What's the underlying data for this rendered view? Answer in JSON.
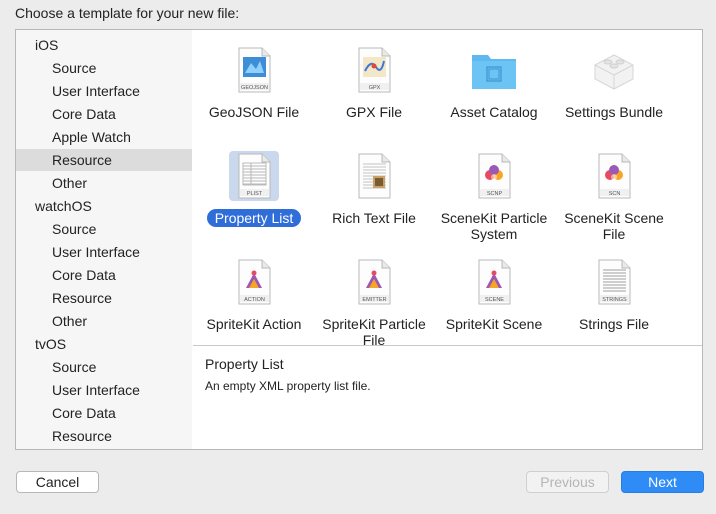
{
  "dialog": {
    "title": "Choose a template for your new file:"
  },
  "sidebar": {
    "items": [
      {
        "label": "iOS",
        "kind": "cat",
        "selected": false
      },
      {
        "label": "Source",
        "kind": "sub",
        "selected": false
      },
      {
        "label": "User Interface",
        "kind": "sub",
        "selected": false
      },
      {
        "label": "Core Data",
        "kind": "sub",
        "selected": false
      },
      {
        "label": "Apple Watch",
        "kind": "sub",
        "selected": false
      },
      {
        "label": "Resource",
        "kind": "sub",
        "selected": true
      },
      {
        "label": "Other",
        "kind": "sub",
        "selected": false
      },
      {
        "label": "watchOS",
        "kind": "cat",
        "selected": false
      },
      {
        "label": "Source",
        "kind": "sub",
        "selected": false
      },
      {
        "label": "User Interface",
        "kind": "sub",
        "selected": false
      },
      {
        "label": "Core Data",
        "kind": "sub",
        "selected": false
      },
      {
        "label": "Resource",
        "kind": "sub",
        "selected": false
      },
      {
        "label": "Other",
        "kind": "sub",
        "selected": false
      },
      {
        "label": "tvOS",
        "kind": "cat",
        "selected": false
      },
      {
        "label": "Source",
        "kind": "sub",
        "selected": false
      },
      {
        "label": "User Interface",
        "kind": "sub",
        "selected": false
      },
      {
        "label": "Core Data",
        "kind": "sub",
        "selected": false
      },
      {
        "label": "Resource",
        "kind": "sub",
        "selected": false
      }
    ]
  },
  "templates": [
    {
      "label": "GeoJSON File",
      "icon": "geojson-file-icon",
      "badge": "GEOJSON",
      "selected": false
    },
    {
      "label": "GPX File",
      "icon": "gpx-file-icon",
      "badge": "GPX",
      "selected": false
    },
    {
      "label": "Asset Catalog",
      "icon": "folder-icon",
      "badge": "",
      "selected": false
    },
    {
      "label": "Settings Bundle",
      "icon": "lego-brick-icon",
      "badge": "",
      "selected": false
    },
    {
      "label": "Property List",
      "icon": "plist-file-icon",
      "badge": "PLIST",
      "selected": true
    },
    {
      "label": "Rich Text File",
      "icon": "rich-text-file-icon",
      "badge": "",
      "selected": false
    },
    {
      "label": "SceneKit Particle System",
      "icon": "scenekit-particle-icon",
      "badge": "SCNP",
      "selected": false
    },
    {
      "label": "SceneKit Scene File",
      "icon": "scenekit-scene-icon",
      "badge": "SCN",
      "selected": false
    },
    {
      "label": "SpriteKit Action",
      "icon": "spritekit-action-icon",
      "badge": "ACTION",
      "selected": false
    },
    {
      "label": "SpriteKit Particle File",
      "icon": "spritekit-emitter-icon",
      "badge": "EMITTER",
      "selected": false
    },
    {
      "label": "SpriteKit Scene",
      "icon": "spritekit-scene-icon",
      "badge": "SCENE",
      "selected": false
    },
    {
      "label": "Strings File",
      "icon": "strings-file-icon",
      "badge": "STRINGS",
      "selected": false
    }
  ],
  "description": {
    "title": "Property List",
    "text": "An empty XML property list file."
  },
  "buttons": {
    "cancel": "Cancel",
    "previous": "Previous",
    "next": "Next"
  },
  "colors": {
    "accent": "#2f6dd9",
    "next_button": "#2f8cf7",
    "folder": "#5fb8f0"
  }
}
